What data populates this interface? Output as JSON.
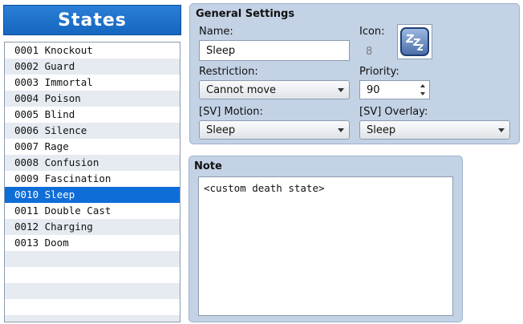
{
  "states": {
    "title": "States",
    "items": [
      "0001 Knockout",
      "0002 Guard",
      "0003 Immortal",
      "0004 Poison",
      "0005 Blind",
      "0006 Silence",
      "0007 Rage",
      "0008 Confusion",
      "0009 Fascination",
      "0010 Sleep",
      "0011 Double Cast",
      "0012 Charging",
      "0013 Doom",
      "",
      "",
      "",
      "",
      ""
    ],
    "selected_index": 9
  },
  "general": {
    "title": "General Settings",
    "name_label": "Name:",
    "name_value": "Sleep",
    "icon_label": "Icon:",
    "icon_index": "8",
    "icon_name": "sleep-zzz-icon",
    "restriction_label": "Restriction:",
    "restriction_value": "Cannot move",
    "priority_label": "Priority:",
    "priority_value": "90",
    "sv_motion_label": "[SV] Motion:",
    "sv_motion_value": "Sleep",
    "sv_overlay_label": "[SV] Overlay:",
    "sv_overlay_value": "Sleep"
  },
  "note": {
    "title": "Note",
    "text": "<custom death state>"
  },
  "colors": {
    "accent": "#1566be",
    "selection": "#0f6dd8",
    "panel_bg": "#c3d2e5",
    "row_alt": "#e6ebf1"
  }
}
